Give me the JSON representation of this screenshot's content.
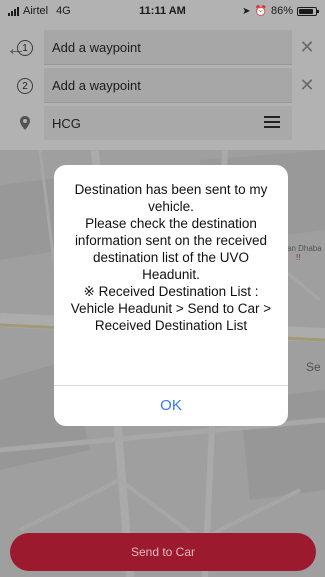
{
  "status": {
    "carrier": "Airtel",
    "network": "4G",
    "time": "11:11 AM",
    "battery": "86%",
    "battery_level": 0.86
  },
  "route": {
    "waypoints": [
      {
        "number": "1",
        "label": "Add a waypoint"
      },
      {
        "number": "2",
        "label": "Add a waypoint"
      }
    ],
    "destination": "HCG"
  },
  "map": {
    "poi_label": "an Dhaba",
    "poi_sub": "!!",
    "road_label": "Se"
  },
  "dialog": {
    "message": "Destination has been sent to my vehicle.\nPlease check the destination information sent on the received destination list of the UVO Headunit.\n※ Received Destination List : Vehicle Headunit > Send to Car > Received Destination List",
    "ok_label": "OK"
  },
  "actions": {
    "send_label": "Send to Car"
  },
  "colors": {
    "accent": "#9b1a2e",
    "link": "#3478f6"
  }
}
